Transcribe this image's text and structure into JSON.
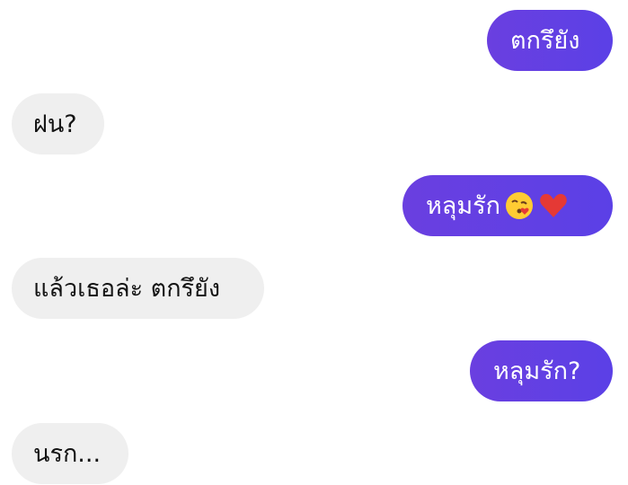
{
  "conversation": {
    "messages": [
      {
        "sender": "me",
        "text": "ตกรึยัง"
      },
      {
        "sender": "them",
        "text": "ฝน?"
      },
      {
        "sender": "me",
        "text": "หลุมรัก",
        "emojis": [
          "face-blowing-kiss-emoji",
          "red-heart-emoji"
        ]
      },
      {
        "sender": "them",
        "text": "แล้วเธอล่ะ ตกรึยัง"
      },
      {
        "sender": "me",
        "text": "หลุมรัก?"
      },
      {
        "sender": "them",
        "text": "นรก..."
      }
    ]
  },
  "colors": {
    "sent_bubble": "#5b40e6",
    "received_bubble": "#efefef",
    "sent_text": "#ffffff",
    "received_text": "#141414",
    "background": "#ffffff"
  }
}
